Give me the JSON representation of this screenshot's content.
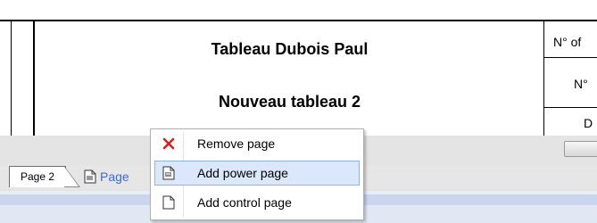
{
  "sheet": {
    "title": "Tableau Dubois Paul",
    "subtitle": "Nouveau tableau 2",
    "cell_row1": "N° of",
    "cell_row2": "N°",
    "cell_row3": "D"
  },
  "tabs": {
    "page2_label": "Page 2",
    "add_page_label": "Page"
  },
  "context_menu": {
    "items": [
      {
        "label": "Remove page",
        "icon": "remove-x-icon"
      },
      {
        "label": "Add power page",
        "icon": "power-page-icon"
      },
      {
        "label": "Add control page",
        "icon": "blank-page-icon"
      }
    ],
    "highlighted_index": 1
  },
  "colors": {
    "accent": "#3b6bd6",
    "remove_icon": "#d81e1e",
    "highlight": "#dbe8fb"
  }
}
